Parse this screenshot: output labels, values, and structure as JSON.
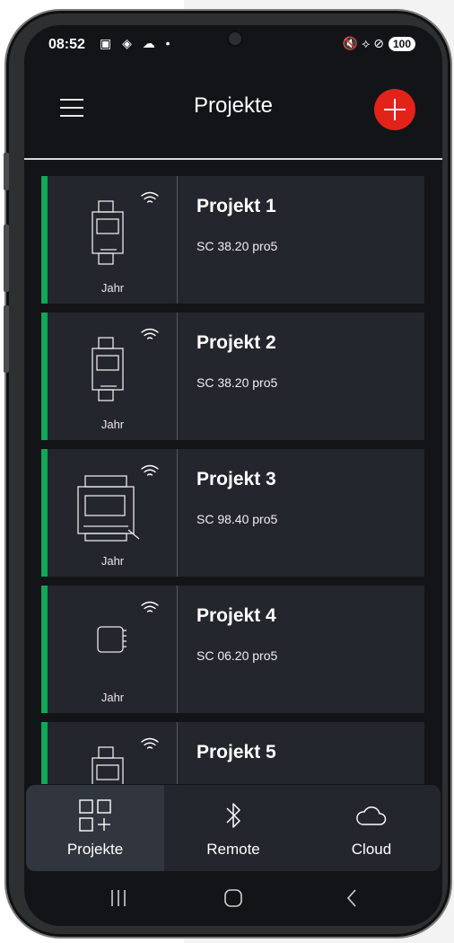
{
  "status_bar": {
    "time": "08:52",
    "left_icons": "▣ ◈ ☁ •",
    "right_icons": "🔇 ⟡ ⊘",
    "battery": "100"
  },
  "app_bar": {
    "title": "Projekte",
    "menu_icon": "hamburger-icon",
    "add_icon": "plus-icon",
    "accent_color": "#e2231a"
  },
  "projects": [
    {
      "name": "Projekt 1",
      "model": "SC 38.20 pro5",
      "mode": "Jahr",
      "device": "din-rail-3"
    },
    {
      "name": "Projekt 2",
      "model": "SC 38.20 pro5",
      "mode": "Jahr",
      "device": "din-rail-3"
    },
    {
      "name": "Projekt 3",
      "model": "SC 98.40 pro5",
      "mode": "Jahr",
      "device": "din-rail-wide"
    },
    {
      "name": "Projekt 4",
      "model": "SC 06.20 pro5",
      "mode": "Jahr",
      "device": "flush-box"
    },
    {
      "name": "Projekt 5",
      "model": "",
      "mode": "",
      "device": "din-rail-3"
    }
  ],
  "status_color": "#12a858",
  "bottom_nav": [
    {
      "label": "Projekte",
      "icon": "grid-plus-icon",
      "active": true
    },
    {
      "label": "Remote",
      "icon": "bluetooth-icon",
      "active": false
    },
    {
      "label": "Cloud",
      "icon": "cloud-icon",
      "active": false
    }
  ],
  "system_nav": [
    "recents-icon",
    "home-icon",
    "back-icon"
  ]
}
